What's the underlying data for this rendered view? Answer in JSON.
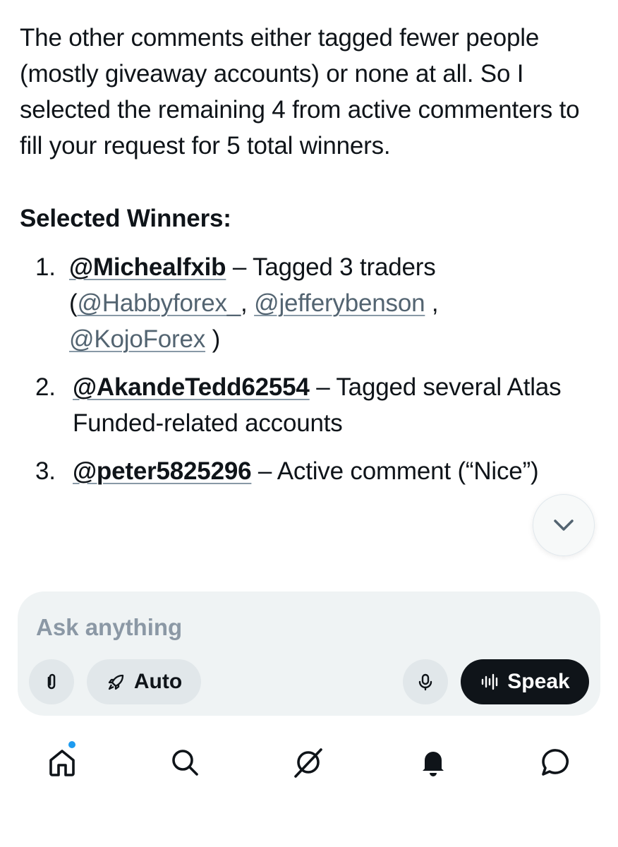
{
  "response": {
    "paragraph": "The other comments either tagged fewer people (mostly giveaway accounts) or none at all. So I selected the remaining 4 from active commenters to fill your request for 5 total winners.",
    "section_title": "Selected Winners:",
    "winners": [
      {
        "number": "1.",
        "handle": "@Michealfxib",
        "desc": " – Tagged 3 traders",
        "tag_open": "(",
        "tag1": "@Habbyforex_",
        "sep1": ", ",
        "tag2": "@jefferybenson",
        "sep2": " ,",
        "tag3": "@KojoForex",
        "tag_close": " )"
      },
      {
        "number": "2.",
        "handle": "@AkandeTedd62554",
        "desc": " – Tagged several Atlas Funded-related accounts"
      },
      {
        "number": "3.",
        "handle": "@peter5825296",
        "desc": " – Active comment (“Nice”)"
      }
    ]
  },
  "composer": {
    "placeholder": "Ask anything",
    "auto_label": "Auto",
    "speak_label": "Speak"
  },
  "icons": {
    "scroll": "chevron-down-icon",
    "attach": "paperclip-icon",
    "auto": "rocket-icon",
    "mic": "microphone-icon",
    "speak": "waveform-icon",
    "nav": [
      "home-icon",
      "search-icon",
      "grok-icon",
      "bell-icon",
      "chat-icon"
    ]
  },
  "colors": {
    "text": "#0f1419",
    "muted": "#536471",
    "accent": "#1d9bf0",
    "composer_bg": "#eff3f4"
  }
}
